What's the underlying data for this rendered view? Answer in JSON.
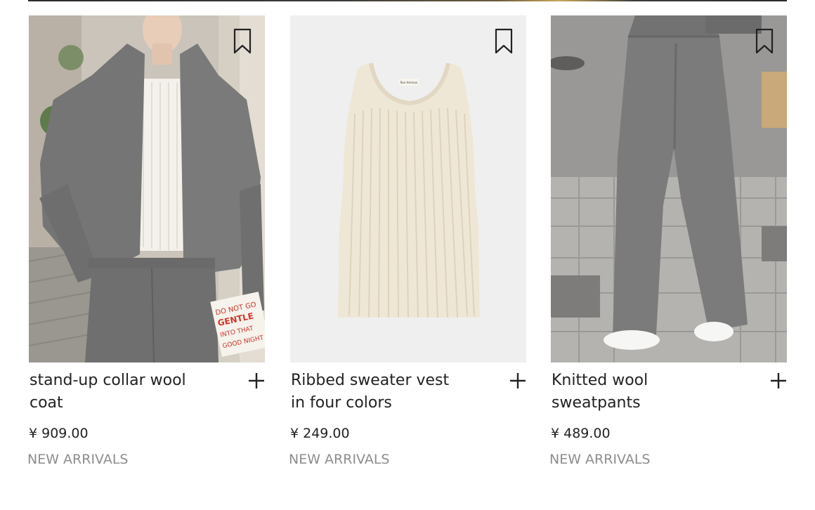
{
  "products": [
    {
      "name": "stand-up collar wool coat",
      "price": "¥ 909.00",
      "tag": "NEW ARRIVALS",
      "image": "model-in-grey-wool-coat",
      "book_text": "DO NOT GO GENTLE INTO THAT GOOD NIGHT"
    },
    {
      "name": "Ribbed sweater vest in four colors",
      "price": "¥ 249.00",
      "tag": "NEW ARRIVALS",
      "image": "cream-ribbed-tank",
      "label_text": "Ron Herman"
    },
    {
      "name": "Knitted wool sweatpants",
      "price": "¥ 489.00",
      "tag": "NEW ARRIVALS",
      "image": "grey-wool-wide-pants"
    }
  ],
  "icons": {
    "bookmark": "bookmark-icon",
    "add": "plus-icon"
  },
  "colors": {
    "text": "#222222",
    "muted": "#8d8d8d",
    "wool_grey": "#7a7a7a",
    "cream": "#efe7d6"
  }
}
